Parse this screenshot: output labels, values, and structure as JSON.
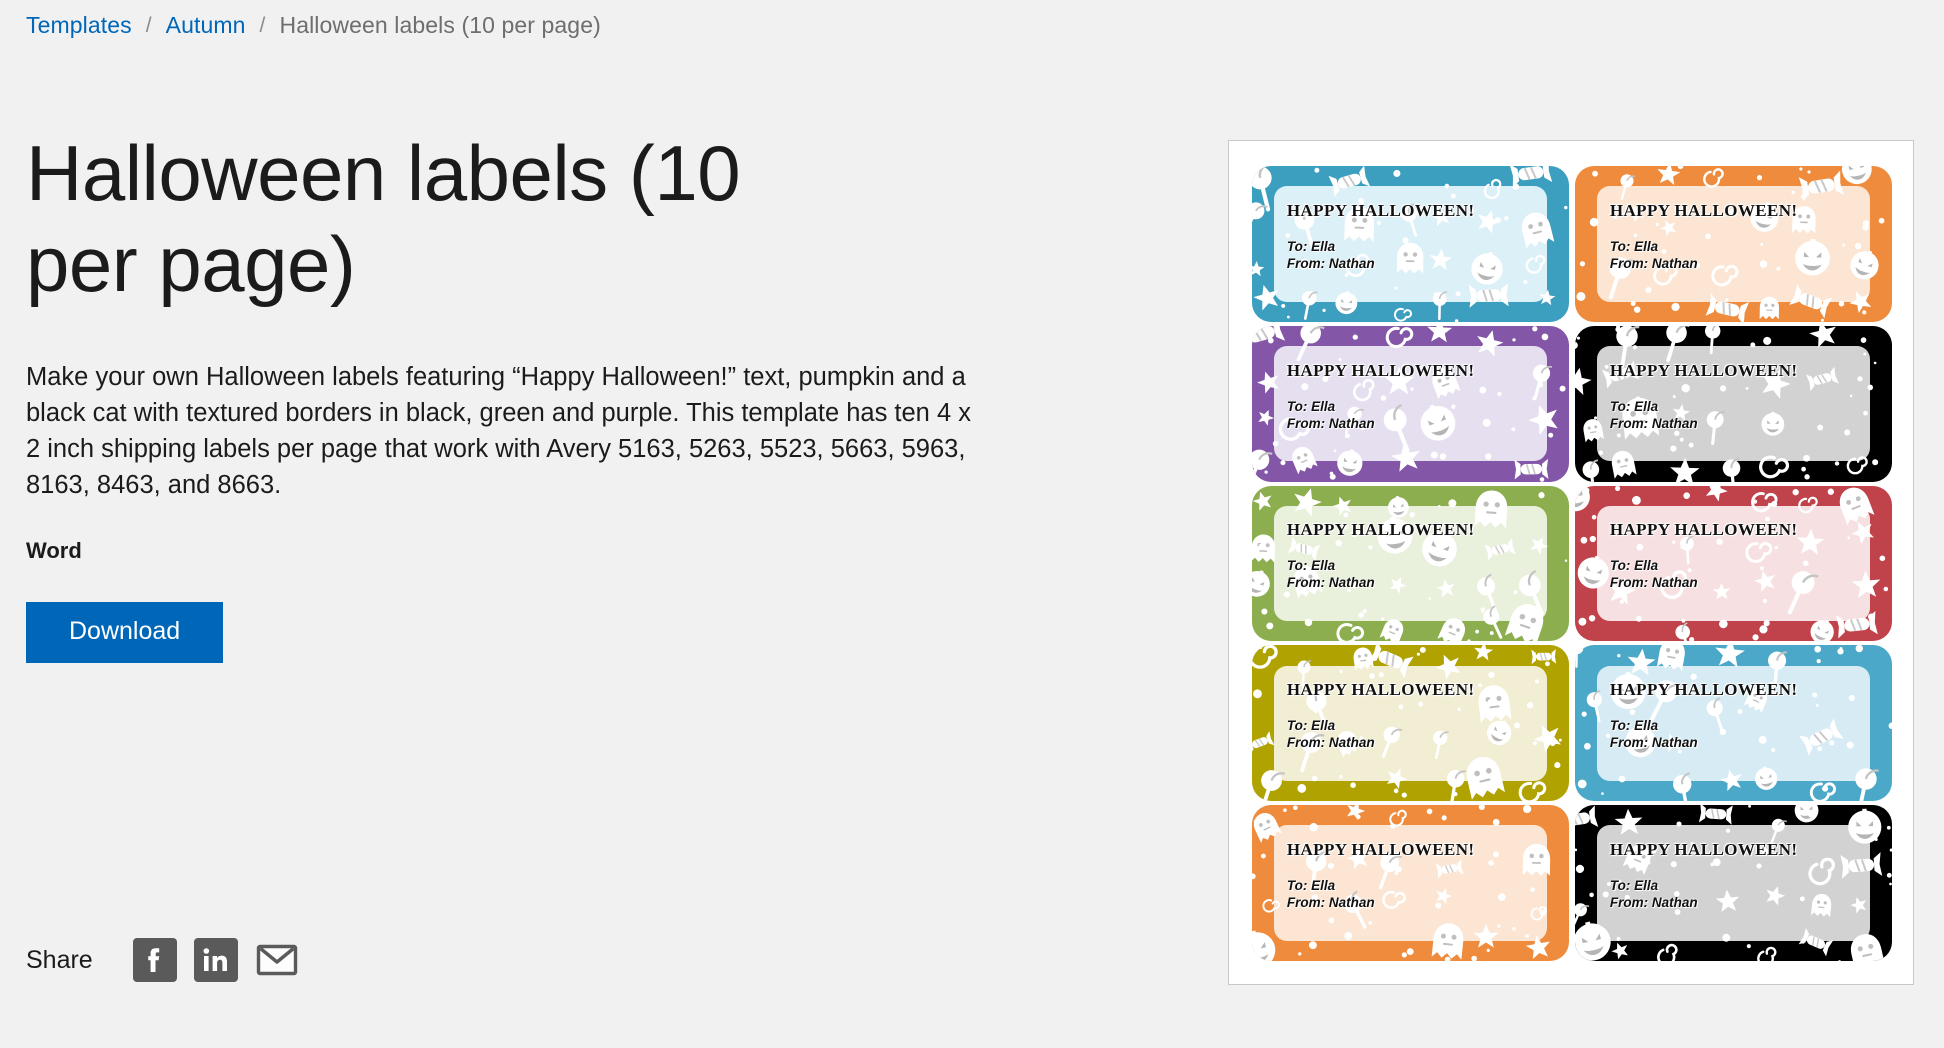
{
  "breadcrumb": {
    "items": [
      {
        "label": "Templates",
        "current": false
      },
      {
        "label": "Autumn",
        "current": false
      },
      {
        "label": "Halloween labels (10 per page)",
        "current": true
      }
    ],
    "separator": "/",
    "link_color": "#0067b8",
    "current_color": "#6e6e6e"
  },
  "main": {
    "title": "Halloween labels (10 per page)",
    "description": "Make your own Halloween labels featuring “Happy Halloween!” text, pumpkin and a black cat with textured borders in black, green and purple. This template has ten 4 x 2 inch shipping labels per page that work with Avery 5163, 5263, 5523, 5663, 5963, 8163, 8463, and 8663.",
    "format_label": "Word",
    "download_label": "Download",
    "download_color": "#0067b8"
  },
  "share": {
    "label": "Share",
    "icons": [
      {
        "name": "facebook-icon",
        "title": "Facebook"
      },
      {
        "name": "linkedin-icon",
        "title": "LinkedIn"
      },
      {
        "name": "email-icon",
        "title": "Email"
      }
    ],
    "icon_color": "#5a5a5a"
  },
  "preview": {
    "label_text": {
      "heading": "HAPPY HALLOWEEN!",
      "to_line": "To: Ella",
      "from_line": "From: Nathan"
    },
    "labels": [
      {
        "position": "row1-left",
        "border_color": "#3d9fbf",
        "inner_color": "#dcf0f7"
      },
      {
        "position": "row1-right",
        "border_color": "#ef8b3c",
        "inner_color": "#fce5d2"
      },
      {
        "position": "row2-left",
        "border_color": "#8456a8",
        "inner_color": "#e6dff0"
      },
      {
        "position": "row2-right",
        "border_color": "#000000",
        "inner_color": "#d2d2d2"
      },
      {
        "position": "row3-left",
        "border_color": "#8cae4f",
        "inner_color": "#e9f0dc"
      },
      {
        "position": "row3-right",
        "border_color": "#c0434b",
        "inner_color": "#f7e0e1"
      },
      {
        "position": "row4-left",
        "border_color": "#b0a200",
        "inner_color": "#f2eed4"
      },
      {
        "position": "row4-right",
        "border_color": "#4ba8c8",
        "inner_color": "#d6ebf4"
      },
      {
        "position": "row5-left",
        "border_color": "#ef8b3c",
        "inner_color": "#fce5d2"
      },
      {
        "position": "row5-right",
        "border_color": "#000000",
        "inner_color": "#d2d2d2"
      }
    ]
  }
}
